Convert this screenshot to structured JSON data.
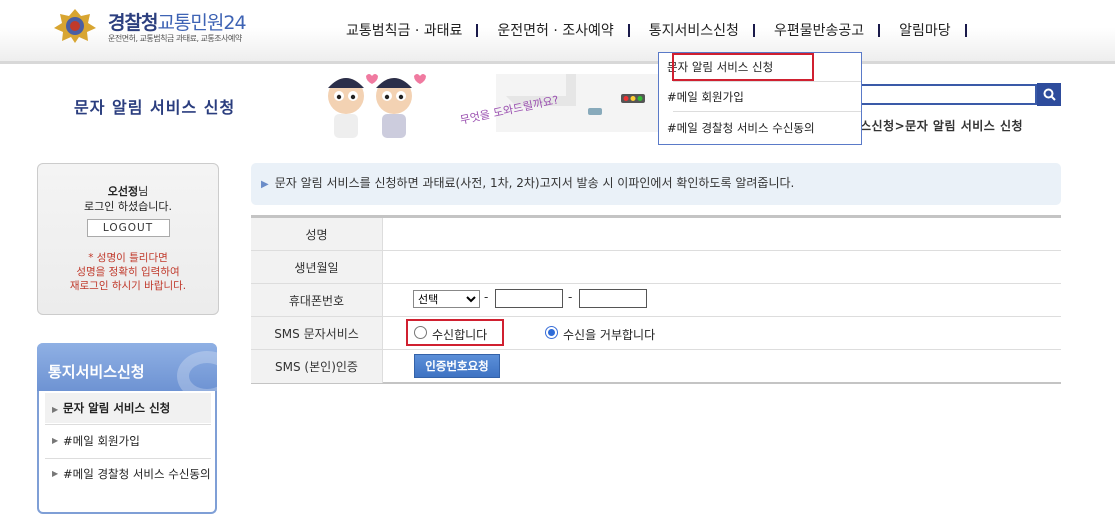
{
  "header": {
    "logo_main_a": "경찰청",
    "logo_main_b": "교통민원24",
    "logo_sub": "운전면허, 교통범칙금 과태료, 교통조사예약",
    "nav": [
      "교통범칙금 · 과태료",
      "운전면허 · 조사예약",
      "통지서비스신청",
      "우편물반송공고",
      "알림마당"
    ]
  },
  "dropdown": {
    "items": [
      "문자 알림 서비스 신청",
      "#메일 회원가입",
      "#메일 경찰청 서비스 수신동의"
    ]
  },
  "page": {
    "title": "문자 알림 서비스 신청",
    "breadcrumb": "스신청>문자 알림 서비스 신청",
    "banner_text": "무엇을 도와드릴까요?"
  },
  "login": {
    "user_name": "오선정",
    "name_suffix": "님",
    "greeting": "로그인 하셨습니다.",
    "logout_label": "LOGOUT",
    "warning": [
      "* 성명이 틀리다면",
      "성명을 정확히 입력하여",
      "재로그인 하시기 바랍니다."
    ]
  },
  "sidebar": {
    "title": "통지서비스신청",
    "items": [
      "문자 알림 서비스 신청",
      "#메일 회원가입",
      "#메일 경찰청 서비스 수신동의"
    ]
  },
  "info": {
    "text": "문자 알림 서비스를 신청하면 과태료(사전, 1차, 2차)고지서 발송 시 이파인에서 확인하도록 알려줍니다."
  },
  "form": {
    "labels": [
      "성명",
      "생년월일",
      "휴대폰번호",
      "SMS 문자서비스",
      "SMS (본인)인증"
    ],
    "carrier_selected": "선택",
    "dash": "-",
    "sms_option_yes": "수신합니다",
    "sms_option_no": "수신을 거부합니다",
    "sms_selected": "no",
    "cert_button": "인증번호요청"
  },
  "colors": {
    "brand_navy": "#2a3d7e",
    "highlight_red": "#d02030",
    "button_blue": "#3f73c3"
  }
}
